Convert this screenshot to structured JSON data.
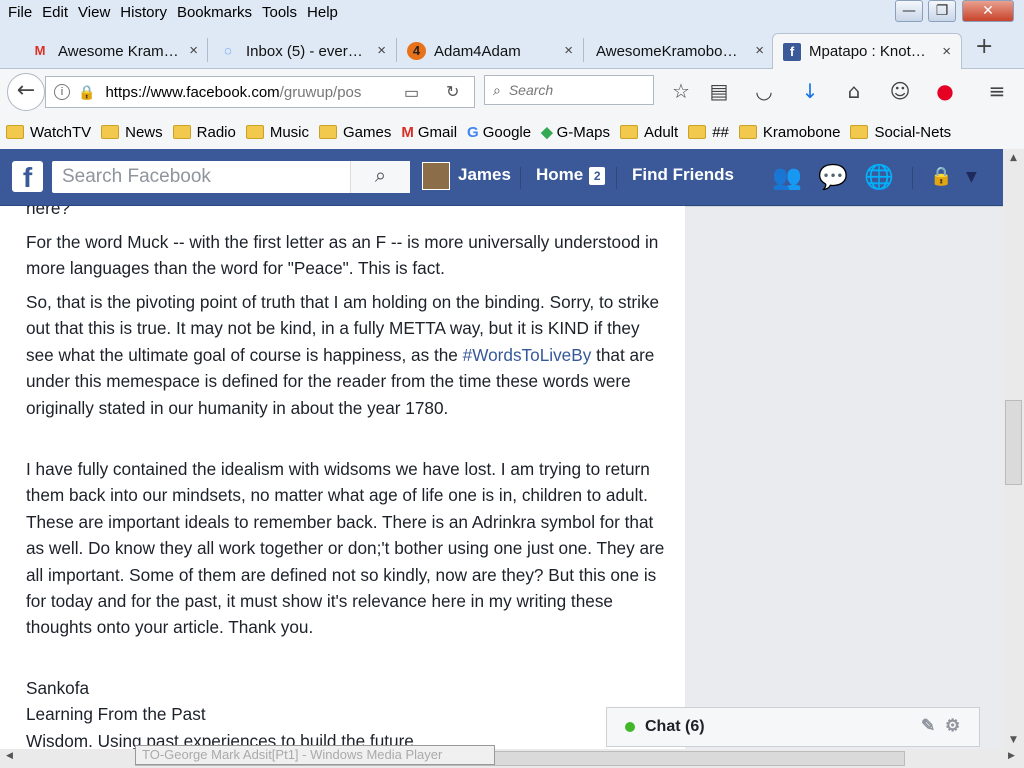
{
  "menu": [
    "File",
    "Edit",
    "View",
    "History",
    "Bookmarks",
    "Tools",
    "Help"
  ],
  "window_controls": {
    "minimize": "—",
    "maximize": "❐",
    "close": "✕"
  },
  "tabs": [
    {
      "label": "Awesome Kram…",
      "icon": "gmail-icon",
      "glyph": "M",
      "color": "#d93025"
    },
    {
      "label": "Inbox (5) - ever…",
      "icon": "loading-icon",
      "glyph": "◌",
      "color": "#1a73e8"
    },
    {
      "label": "Adam4Adam",
      "icon": "adam4adam-icon",
      "glyph": "4",
      "color": "#e8711a"
    },
    {
      "label": "AwesomeKramobo…",
      "icon": "blank-page-icon",
      "glyph": "",
      "color": "#888"
    },
    {
      "label": "Mpatapo : Knot…",
      "icon": "facebook-icon",
      "glyph": "f",
      "color": "#3b5998",
      "active": true
    }
  ],
  "tab_close": "×",
  "new_tab": "+",
  "nav": {
    "back": "←",
    "url_host": "https://www.facebook.com",
    "url_path": "/gruwup/pos",
    "search_placeholder": "Search",
    "reload": "↻"
  },
  "bookmarks": [
    {
      "label": "WatchTV",
      "type": "folder"
    },
    {
      "label": "News",
      "type": "folder"
    },
    {
      "label": "Radio",
      "type": "folder"
    },
    {
      "label": "Music",
      "type": "folder"
    },
    {
      "label": "Games",
      "type": "folder"
    },
    {
      "label": "Gmail",
      "type": "gmail"
    },
    {
      "label": "Google",
      "type": "google"
    },
    {
      "label": "G-Maps",
      "type": "maps"
    },
    {
      "label": "Adult",
      "type": "folder"
    },
    {
      "label": "##",
      "type": "folder"
    },
    {
      "label": "Kramobone",
      "type": "folder"
    },
    {
      "label": "Social-Nets",
      "type": "folder"
    }
  ],
  "facebook": {
    "logo": "f",
    "search_placeholder": "Search Facebook",
    "user": "James",
    "home": "Home",
    "home_badge": "2",
    "find_friends": "Find Friends"
  },
  "post": {
    "partial_top": "here?",
    "p1": "For the word Muck -- with the first letter as an F -- is more universally understood in more languages than the word for \"Peace\". This is fact.",
    "p2_a": "So, that is the pivoting point of truth that I am holding on the binding. Sorry, to strike out that this is true. It may not be kind, in a fully METTA way, but it is KIND if they see what the ultimate goal of course is happiness, as the ",
    "p2_hashtag": "#WordsToLiveBy",
    "p2_b": " that are under this memespace is defined for the reader from the time these words were originally stated in our humanity in about the year 1780.",
    "p3": "I have fully contained the idealism with widsoms we have lost. I am trying to return them back into our mindsets, no matter what age of life one is in, children to adult. These are important ideals to remember back. There is an Adrinkra symbol for that as well. Do know they all work together or don;'t bother using one just one. They are all important. Some of them are defined not so kindly, now are they? But this one is for today and for the past, it must show it's relevance here in my writing these thoughts onto your article. Thank you.",
    "p4_line1": "Sankofa",
    "p4_line2": "Learning From the Past",
    "p4_line3": "Wisdom. Using past experiences to build the future"
  },
  "chat": {
    "label": "Chat (6)"
  },
  "taskbar_item": "TO-George Mark Adsit[Pt1] - Windows Media Player"
}
